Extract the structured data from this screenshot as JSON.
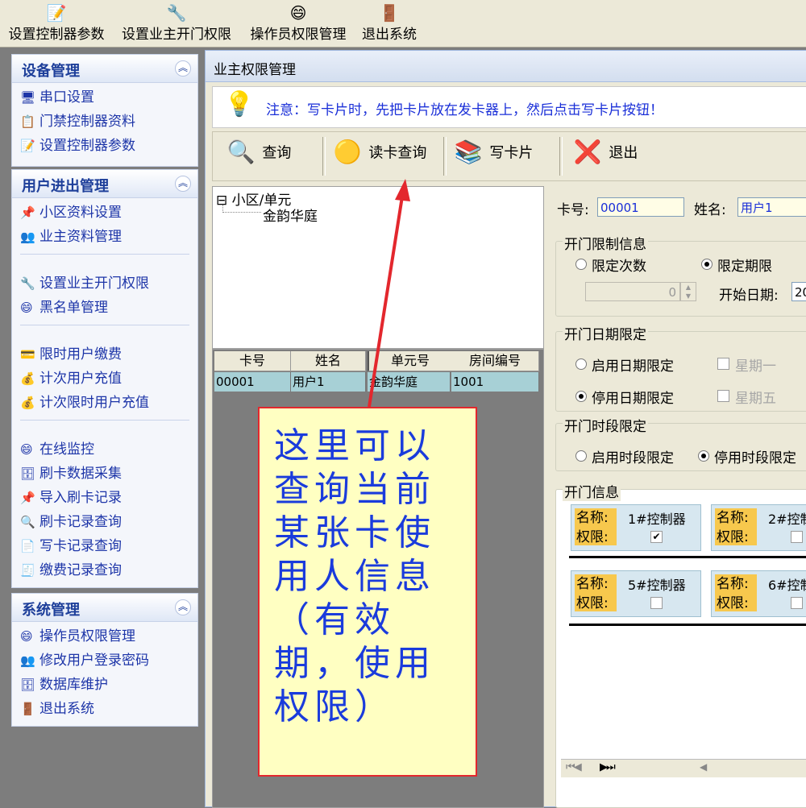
{
  "toolbar": {
    "items": [
      {
        "label": "设置控制器参数",
        "icon": "settings-doc-icon"
      },
      {
        "label": "设置业主开门权限",
        "icon": "permission-icon"
      },
      {
        "label": "操作员权限管理",
        "icon": "operator-face-icon"
      },
      {
        "label": "退出系统",
        "icon": "exit-door-icon"
      }
    ]
  },
  "sidebar": {
    "groups": [
      {
        "title": "设备管理",
        "items": [
          "串口设置",
          "门禁控制器资料",
          "设置控制器参数"
        ]
      },
      {
        "title": "用户进出管理",
        "items": [
          "小区资料设置",
          "业主资料管理",
          "设置业主开门权限",
          "黑名单管理",
          "限时用户缴费",
          "计次用户充值",
          "计次限时用户充值",
          "在线监控",
          "刷卡数据采集",
          "导入刷卡记录",
          "刷卡记录查询",
          "写卡记录查询",
          "缴费记录查询"
        ]
      },
      {
        "title": "系统管理",
        "items": [
          "操作员权限管理",
          "修改用户登录密码",
          "数据库维护",
          "退出系统"
        ]
      }
    ]
  },
  "window": {
    "title": "业主权限管理",
    "notice": "注意：写卡片时，先把卡片放在发卡器上，然后点击写卡片按钮！",
    "actions": [
      "查询",
      "读卡查询",
      "写卡片",
      "退出"
    ]
  },
  "tree": {
    "root": "小区/单元",
    "child": "金韵华庭"
  },
  "grid": {
    "columns": [
      "卡号",
      "姓名",
      "单元号",
      "房间编号"
    ],
    "rows": [
      [
        "00001",
        "用户1",
        "金韵华庭",
        "1001"
      ]
    ]
  },
  "card": {
    "card_no_label": "卡号:",
    "card_no": "00001",
    "name_label": "姓名:",
    "name": "用户1"
  },
  "limit": {
    "title": "开门限制信息",
    "opt_count": "限定次数",
    "opt_period": "限定期限",
    "count_value": "0",
    "start_label": "开始日期:",
    "start_value": "20"
  },
  "date_limit": {
    "title": "开门日期限定",
    "enable": "启用日期限定",
    "disable": "停用日期限定",
    "mon": "星期一",
    "fri": "星期五"
  },
  "time_limit": {
    "title": "开门时段限定",
    "enable": "启用时段限定",
    "disable": "停用时段限定"
  },
  "door_info": {
    "title": "开门信息",
    "name_label": "名称:",
    "perm_label": "权限:",
    "controllers": [
      "1#控制器",
      "2#控制",
      "5#控制器",
      "6#控制"
    ]
  },
  "annotation": {
    "text": "这里可以查询当前某张卡使用人信息（有效期，使用权限）",
    "color": "#e3272d"
  }
}
